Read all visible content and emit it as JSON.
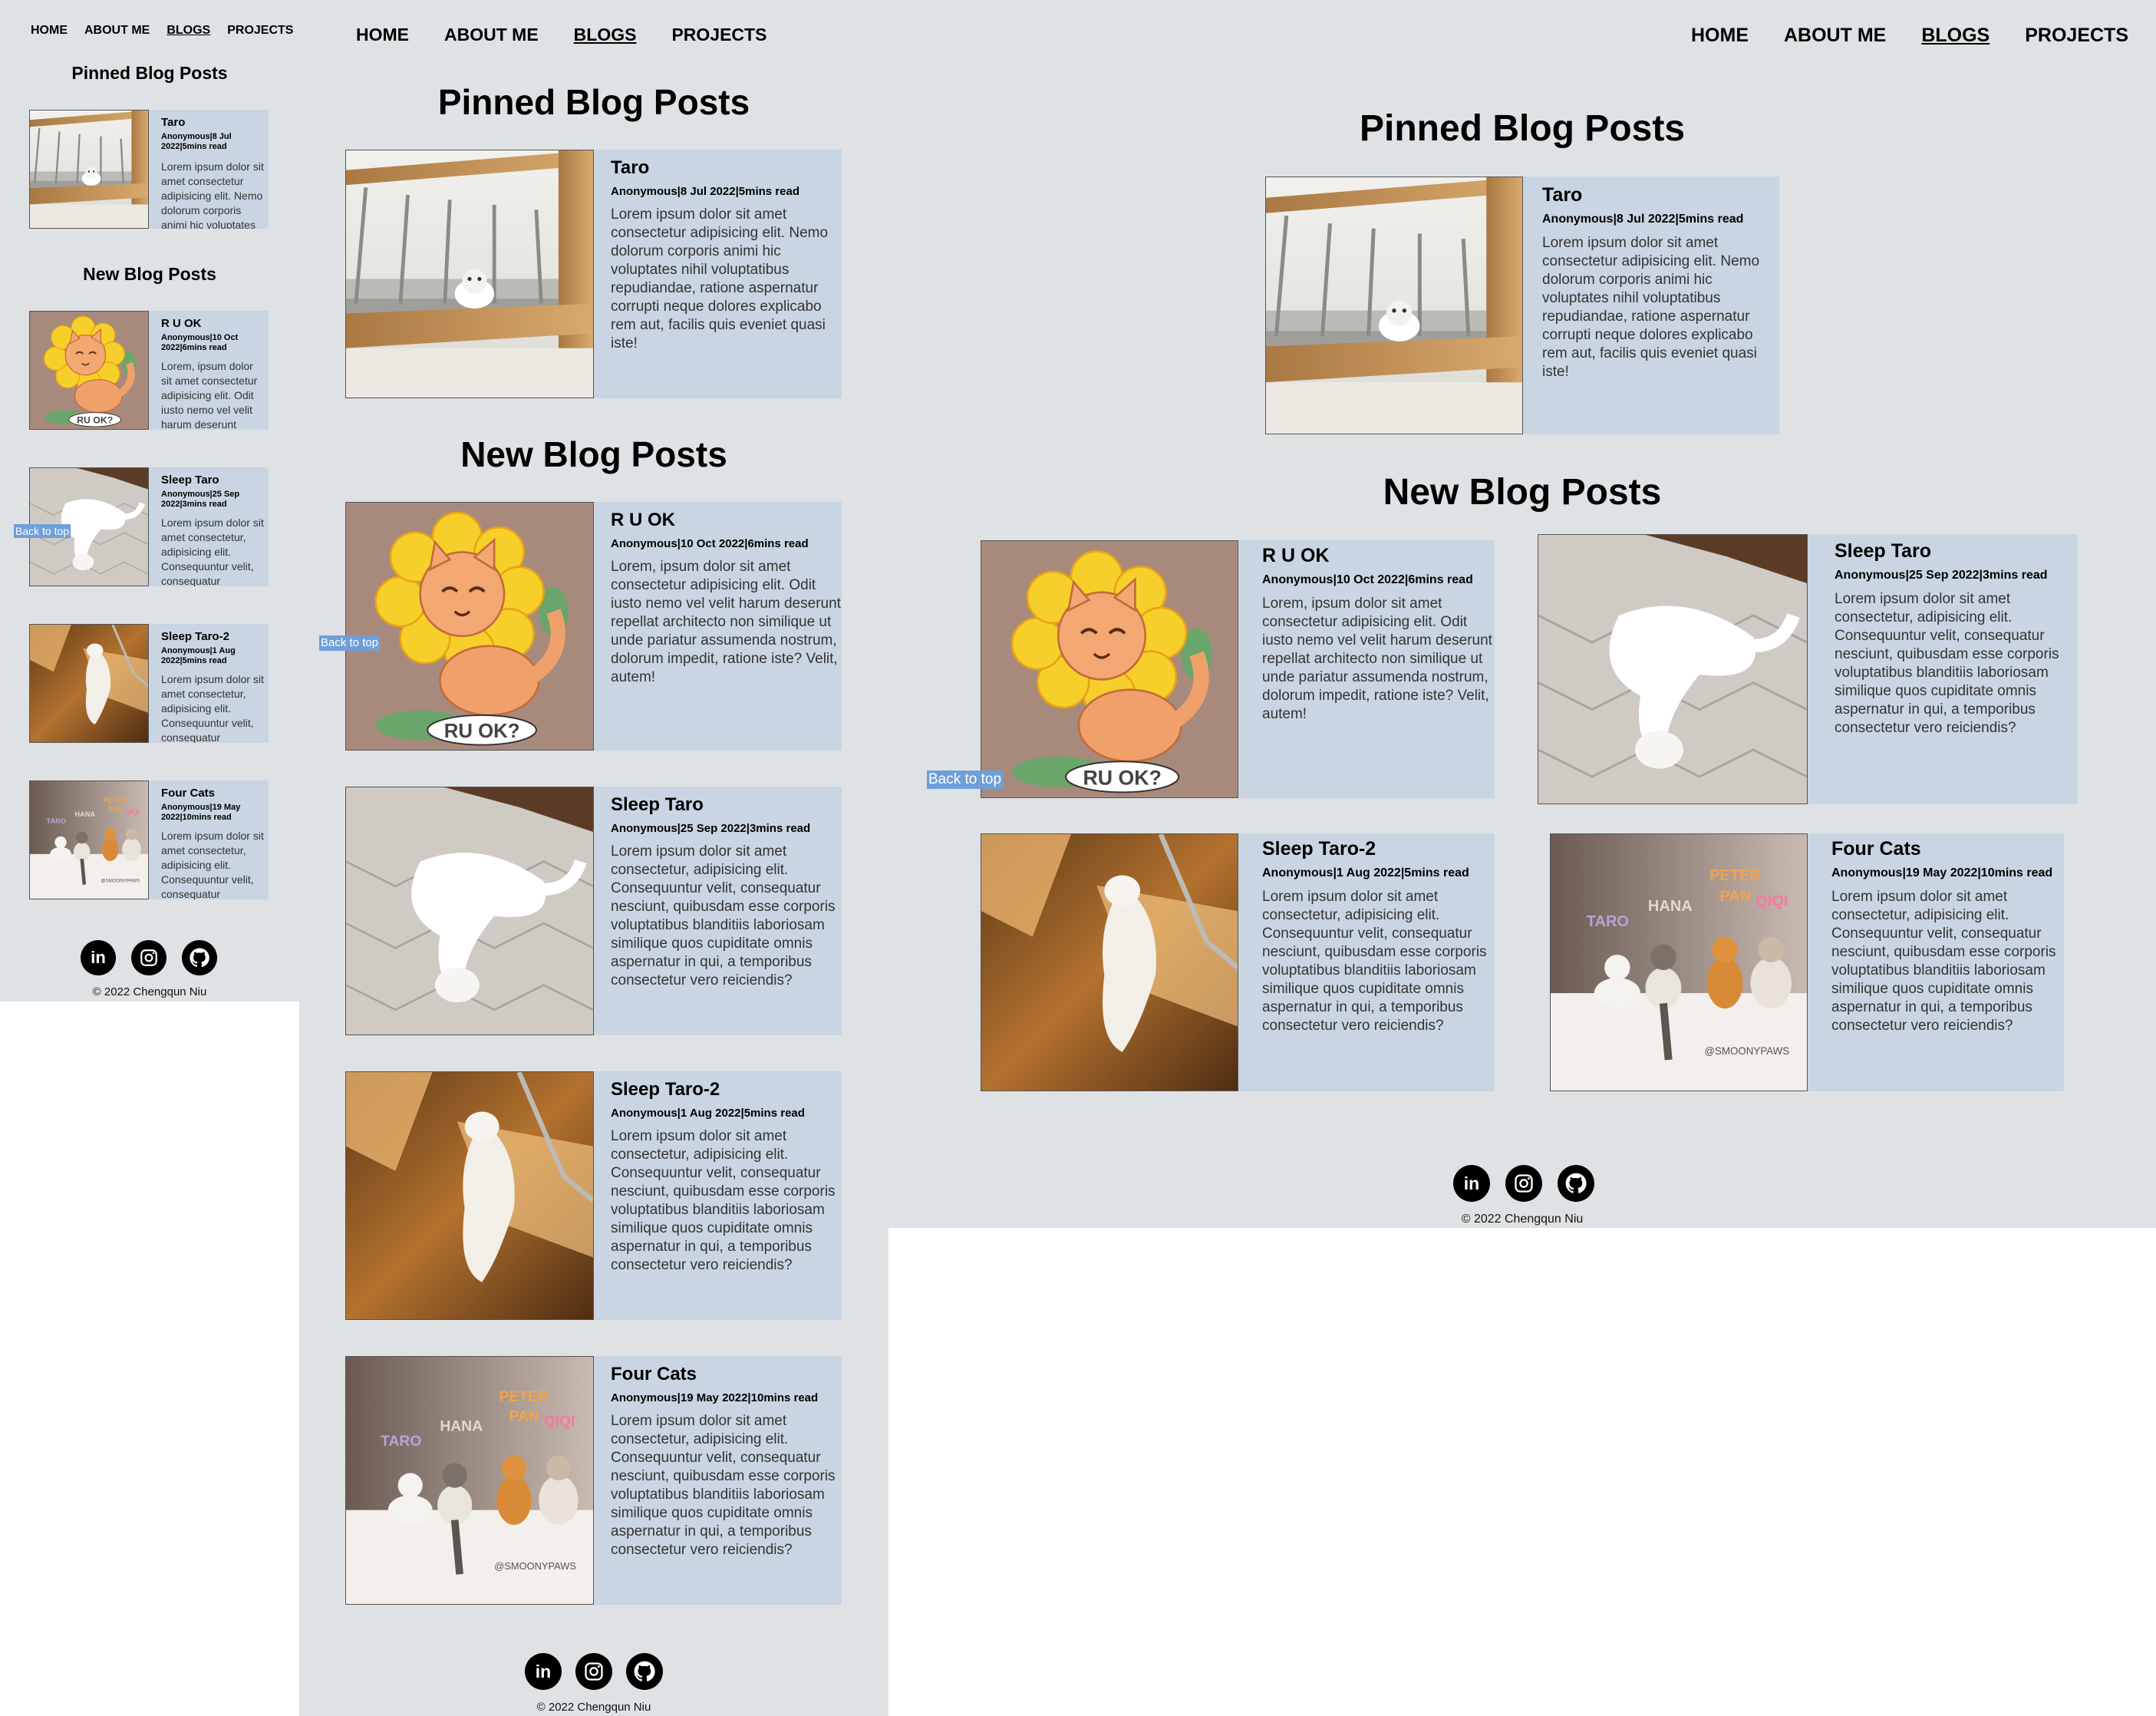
{
  "nav": {
    "home": "HOME",
    "about": "ABOUT ME",
    "blogs": "BLOGS",
    "projects": "PROJECTS"
  },
  "sections": {
    "pinned": "Pinned Blog Posts",
    "new": "New Blog Posts"
  },
  "back_to_top": "Back to top",
  "footer": {
    "copyright": "© 2022 Chengqun Niu",
    "icons": [
      "linkedin-icon",
      "instagram-icon",
      "github-icon"
    ]
  },
  "posts": {
    "taro": {
      "title": "Taro",
      "meta": "Anonymous|8 Jul 2022|5mins read",
      "text": "Lorem ipsum dolor sit amet consectetur adipisicing elit. Nemo dolorum corporis animi hic voluptates nihil voluptatibus repudiandae, ratione aspernatur corrupti neque dolores explicabo rem aut, facilis quis eveniet quasi iste!",
      "text_short": "Lorem ipsum dolor sit amet consectetur adipisicing elit. Nemo dolorum"
    },
    "ruok": {
      "title": "R U OK",
      "meta": "Anonymous|10 Oct 2022|6mins read",
      "text": "Lorem, ipsum dolor sit amet consectetur adipisicing elit. Odit iusto nemo vel velit harum deserunt repellat architecto non similique ut unde pariatur assumenda nostrum, dolorum impedit, ratione iste? Velit, autem!",
      "text_short": "Lorem, ipsum dolor sit amet consectetur adipisicing elit. Odit iusto nemo vel velit"
    },
    "sleep": {
      "title": "Sleep Taro",
      "meta": "Anonymous|25 Sep 2022|3mins read",
      "text": "Lorem ipsum dolor sit amet consectetur, adipisicing elit. Consequuntur velit, consequatur nesciunt, quibusdam esse corporis voluptatibus blanditiis laboriosam similique quos cupiditate omnis aspernatur in qui, a temporibus consectetur vero reiciendis?",
      "text_short": "Lorem ipsum dolor sit amet consectetur, adipisicing elit. Consequuntur velit"
    },
    "sleep2": {
      "title": "Sleep Taro-2",
      "meta": "Anonymous|1 Aug 2022|5mins read",
      "text": "Lorem ipsum dolor sit amet consectetur, adipisicing elit. Consequuntur velit, consequatur nesciunt, quibusdam esse corporis voluptatibus blanditiis laboriosam similique quos cupiditate omnis aspernatur in qui, a temporibus consectetur vero reiciendis?",
      "text_short": "Lorem ipsum dolor sit amet consectetur, adipisicing elit. Consequuntur velit"
    },
    "four": {
      "title": "Four Cats",
      "meta": "Anonymous|19 May 2022|10mins read",
      "text": "Lorem ipsum dolor sit amet consectetur, adipisicing elit. Consequuntur velit, consequatur nesciunt, quibusdam esse corporis voluptatibus blanditiis laboriosam similique quos cupiditate omnis aspernatur in qui, a temporibus consectetur vero reiciendis?",
      "text_short": "Lorem ipsum dolor sit amet consectetur, adipisicing elit. Consequuntur velit"
    }
  },
  "image_text": {
    "ruok_caption": "RU OK?",
    "cat_names": [
      "TARO",
      "HANA",
      "PETER",
      "PAN",
      "QIQI"
    ],
    "watermark": "@SMOONYPAWS"
  },
  "colors": {
    "background": "#dfe2e4",
    "card": "#c9d5e2",
    "back_to_top": "#6f9fd8"
  }
}
